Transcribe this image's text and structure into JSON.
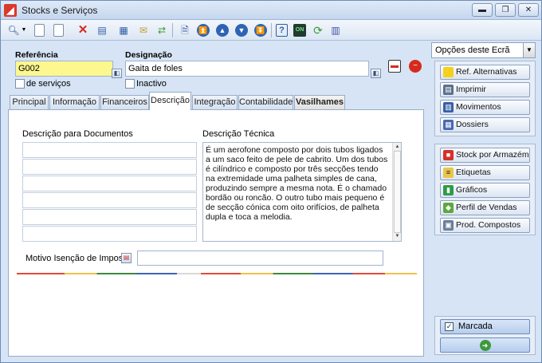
{
  "window": {
    "title": "Stocks e Serviços",
    "minimize": "▬",
    "restore": "❐",
    "close": "✕"
  },
  "form": {
    "referencia_label": "Referência",
    "referencia_value": "G002",
    "designacao_label": "Designação",
    "designacao_value": "Gaita de foles",
    "de_servicos_label": "de serviços",
    "inactivo_label": "Inactivo"
  },
  "tabs": [
    {
      "label": "Principal"
    },
    {
      "label": "Informação"
    },
    {
      "label": "Financeiros"
    },
    {
      "label": "Descrição"
    },
    {
      "label": "Integração"
    },
    {
      "label": "Contabilidade"
    },
    {
      "label": "Vasilhames"
    }
  ],
  "descricao": {
    "docs_label": "Descrição para Documentos",
    "tecnica_label": "Descrição Técnica",
    "tecnica_text": "É um aerofone composto por dois tubos ligados a um saco feito de pele de cabrito. Um dos tubos é cilíndrico e composto por três secções tendo na extremidade uma palheta simples de cana, produzindo sempre a mesma nota. É o chamado bordão ou roncão. O outro tubo mais pequeno é de secção cónica com oito orifícios, de palheta dupla e toca a melodia.",
    "motivo_label": "Motivo Isenção de Imposto",
    "motivo_value": ""
  },
  "side": {
    "select_value": "Opções deste Ecrã",
    "group1": [
      {
        "label": "Ref. Alternativas"
      },
      {
        "label": "Imprimir"
      },
      {
        "label": "Movimentos"
      },
      {
        "label": "Dossiers"
      }
    ],
    "group2": [
      {
        "label": "Stock por Armazém"
      },
      {
        "label": "Etiquetas"
      },
      {
        "label": "Gráficos"
      },
      {
        "label": "Perfil de Vendas"
      },
      {
        "label": "Prod. Compostos"
      }
    ],
    "marcada_label": "Marcada"
  }
}
